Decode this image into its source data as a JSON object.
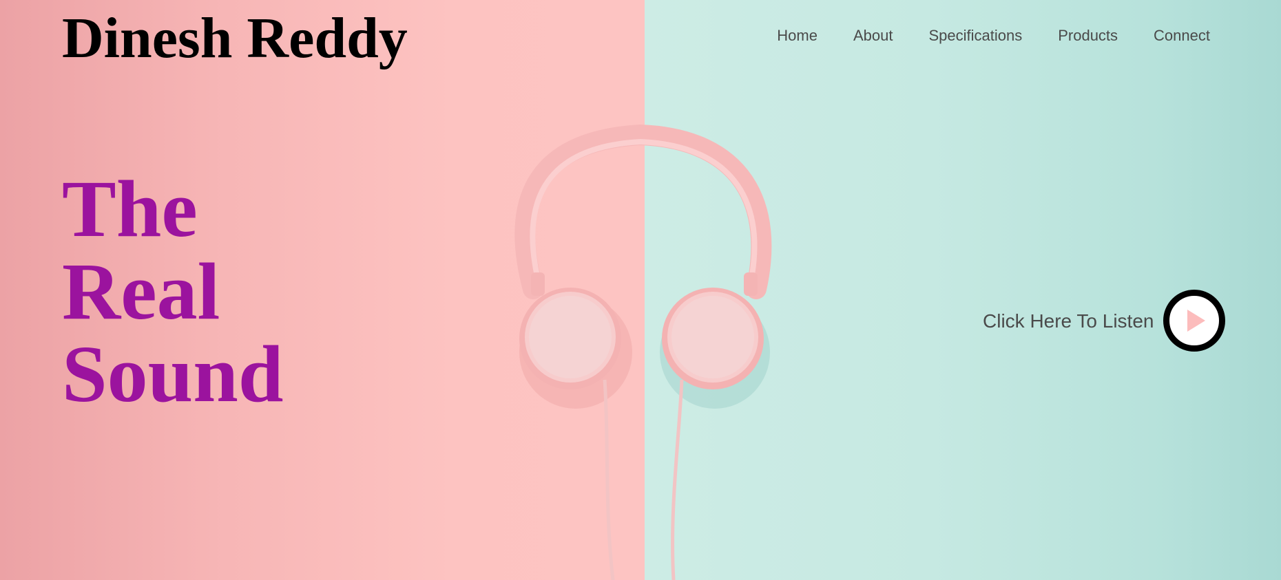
{
  "header": {
    "brand": "Dinesh Reddy",
    "nav": [
      {
        "label": "Home"
      },
      {
        "label": "About"
      },
      {
        "label": "Specifications"
      },
      {
        "label": "Products"
      },
      {
        "label": "Connect"
      }
    ]
  },
  "hero": {
    "headline_lines": [
      "The",
      "Real",
      "Sound"
    ],
    "listen_label": "Click Here To Listen",
    "play_icon": "play-icon",
    "image": "pink-headphones-on-pink-and-mint-background"
  },
  "colors": {
    "headline": "#9b139e",
    "brand": "#000000",
    "nav_text": "#4a4a4a",
    "bg_pink": "#fdc4c2",
    "bg_mint": "#c6e9e2",
    "play_border": "#000000",
    "play_triangle": "#fcbcbc"
  }
}
